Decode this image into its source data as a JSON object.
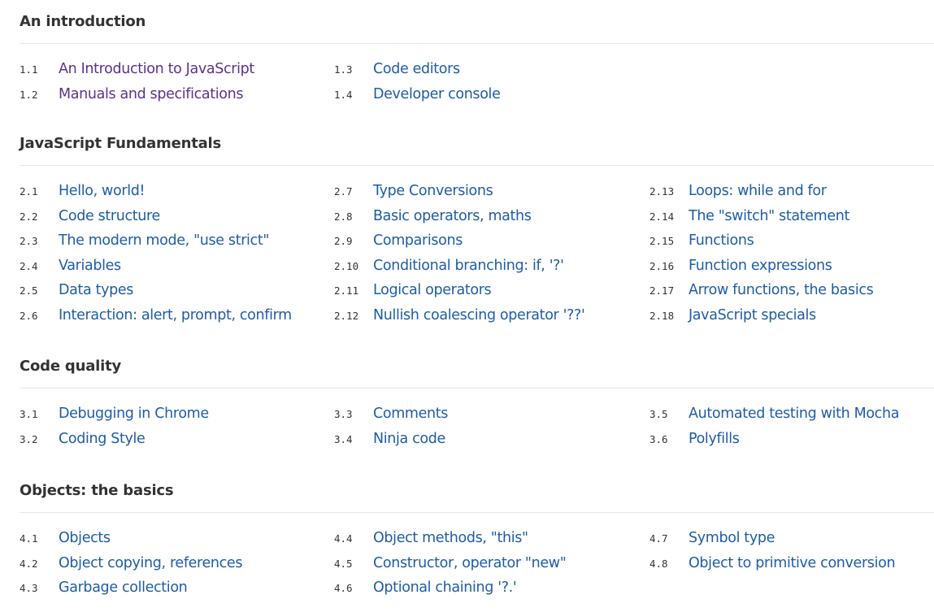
{
  "colors": {
    "link": "#1e5ca8",
    "visited_link": "#5b3290",
    "heading": "#333333",
    "rule": "#e6e6e6"
  },
  "sections": [
    {
      "title": "An introduction",
      "rows": 2,
      "items": [
        {
          "num": "1.1",
          "label": "An Introduction to JavaScript",
          "visited": true
        },
        {
          "num": "1.2",
          "label": "Manuals and specifications",
          "visited": true
        },
        {
          "num": "1.3",
          "label": "Code editors",
          "visited": false
        },
        {
          "num": "1.4",
          "label": "Developer console",
          "visited": false
        }
      ]
    },
    {
      "title": "JavaScript Fundamentals",
      "rows": 6,
      "items": [
        {
          "num": "2.1",
          "label": "Hello, world!",
          "visited": false
        },
        {
          "num": "2.2",
          "label": "Code structure",
          "visited": false
        },
        {
          "num": "2.3",
          "label": "The modern mode, \"use strict\"",
          "visited": false
        },
        {
          "num": "2.4",
          "label": "Variables",
          "visited": false
        },
        {
          "num": "2.5",
          "label": "Data types",
          "visited": false
        },
        {
          "num": "2.6",
          "label": "Interaction: alert, prompt, confirm",
          "visited": false
        },
        {
          "num": "2.7",
          "label": "Type Conversions",
          "visited": false
        },
        {
          "num": "2.8",
          "label": "Basic operators, maths",
          "visited": false
        },
        {
          "num": "2.9",
          "label": "Comparisons",
          "visited": false
        },
        {
          "num": "2.10",
          "label": "Conditional branching: if, '?'",
          "visited": false
        },
        {
          "num": "2.11",
          "label": "Logical operators",
          "visited": false
        },
        {
          "num": "2.12",
          "label": "Nullish coalescing operator '??'",
          "visited": false
        },
        {
          "num": "2.13",
          "label": "Loops: while and for",
          "visited": false
        },
        {
          "num": "2.14",
          "label": "The \"switch\" statement",
          "visited": false
        },
        {
          "num": "2.15",
          "label": "Functions",
          "visited": false
        },
        {
          "num": "2.16",
          "label": "Function expressions",
          "visited": false
        },
        {
          "num": "2.17",
          "label": "Arrow functions, the basics",
          "visited": false
        },
        {
          "num": "2.18",
          "label": "JavaScript specials",
          "visited": false
        }
      ]
    },
    {
      "title": "Code quality",
      "rows": 2,
      "items": [
        {
          "num": "3.1",
          "label": "Debugging in Chrome",
          "visited": false
        },
        {
          "num": "3.2",
          "label": "Coding Style",
          "visited": false
        },
        {
          "num": "3.3",
          "label": "Comments",
          "visited": false
        },
        {
          "num": "3.4",
          "label": "Ninja code",
          "visited": false
        },
        {
          "num": "3.5",
          "label": "Automated testing with Mocha",
          "visited": false
        },
        {
          "num": "3.6",
          "label": "Polyfills",
          "visited": false
        }
      ]
    },
    {
      "title": "Objects: the basics",
      "rows": 3,
      "items": [
        {
          "num": "4.1",
          "label": "Objects",
          "visited": false
        },
        {
          "num": "4.2",
          "label": "Object copying, references",
          "visited": false
        },
        {
          "num": "4.3",
          "label": "Garbage collection",
          "visited": false
        },
        {
          "num": "4.4",
          "label": "Object methods, \"this\"",
          "visited": false
        },
        {
          "num": "4.5",
          "label": "Constructor, operator \"new\"",
          "visited": false
        },
        {
          "num": "4.6",
          "label": "Optional chaining '?.'",
          "visited": false
        },
        {
          "num": "4.7",
          "label": "Symbol type",
          "visited": false
        },
        {
          "num": "4.8",
          "label": "Object to primitive conversion",
          "visited": false
        }
      ]
    }
  ]
}
